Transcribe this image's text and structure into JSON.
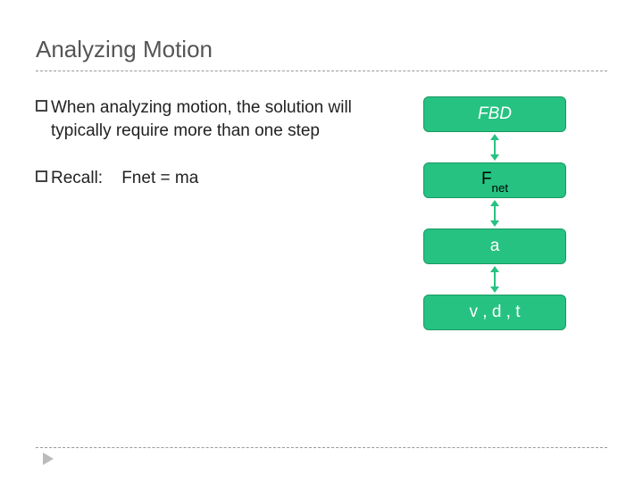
{
  "title": "Analyzing Motion",
  "bullets": {
    "b1": "When analyzing motion, the solution will typically require more than one step",
    "b2_label": "Recall:",
    "b2_eq": "Fnet = ma"
  },
  "diagram": {
    "box1": "FBD",
    "box2_main": "F",
    "box2_sub": "net",
    "box3": "a",
    "box4": "v , d , t"
  }
}
